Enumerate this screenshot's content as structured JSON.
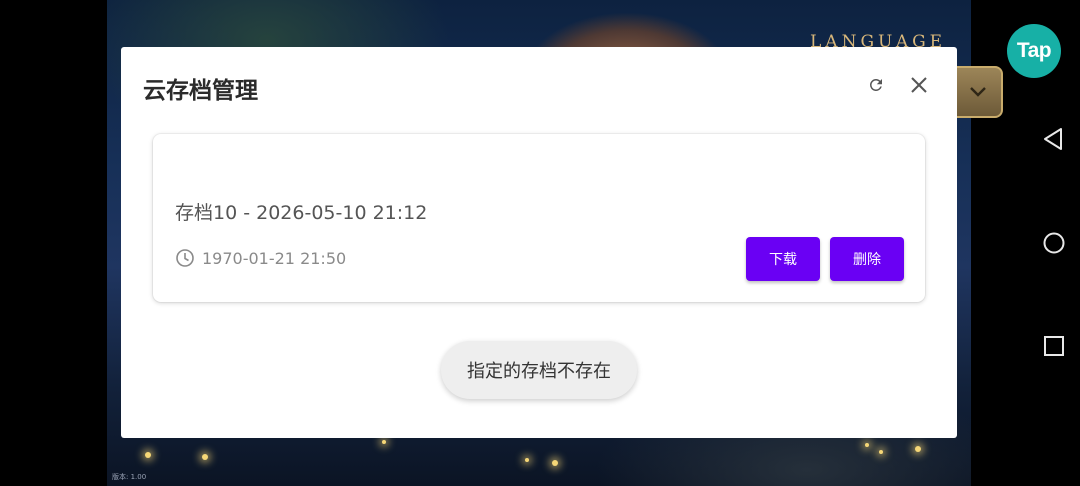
{
  "background": {
    "language_label": "LANGUAGE",
    "version_text": "版本: 1.00",
    "behind_dialog_text": "·····"
  },
  "taptap": {
    "label": "Tap",
    "color": "#17b0a6"
  },
  "dialog": {
    "title": "云存档管理",
    "refresh_icon": "refresh-icon",
    "close_icon": "close-icon",
    "save": {
      "name": "存档10 - 2026-05-10 21:12",
      "timestamp": "1970-01-21 21:50",
      "download_label": "下载",
      "delete_label": "删除"
    },
    "toast": "指定的存档不存在"
  },
  "colors": {
    "accent": "#6a00f4",
    "toast_bg": "#eeeeee"
  },
  "nav": {
    "back_icon": "back-triangle-icon",
    "home_icon": "home-circle-icon",
    "recent_icon": "recent-square-icon"
  }
}
